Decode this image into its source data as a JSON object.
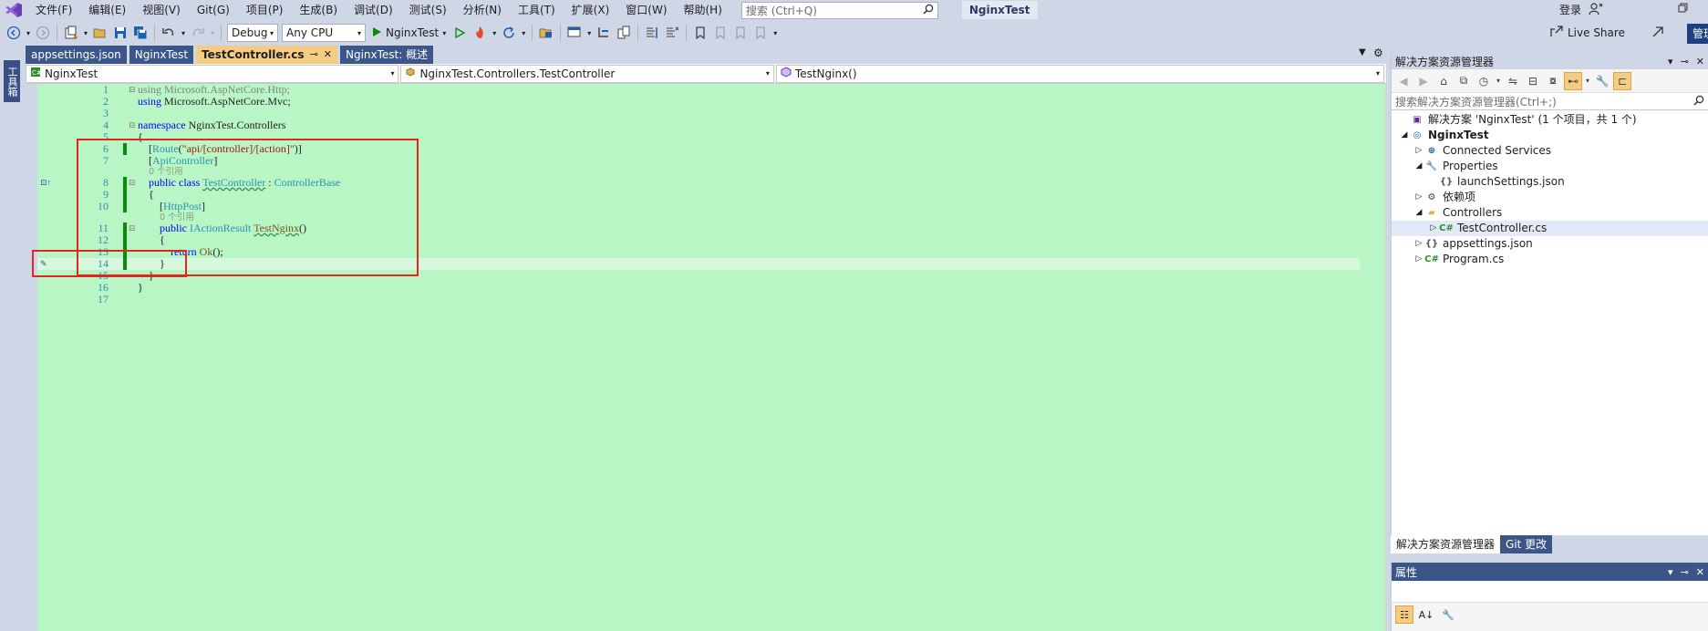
{
  "menubar": {
    "items": [
      "文件(F)",
      "编辑(E)",
      "视图(V)",
      "Git(G)",
      "项目(P)",
      "生成(B)",
      "调试(D)",
      "测试(S)",
      "分析(N)",
      "工具(T)",
      "扩展(X)",
      "窗口(W)",
      "帮助(H)"
    ],
    "search_placeholder": "搜索 (Ctrl+Q)",
    "solution_name": "NginxTest",
    "login": "登录"
  },
  "toolbar": {
    "configuration": "Debug",
    "platform": "Any CPU",
    "start_label": "NginxTest",
    "live_share": "Live Share",
    "manage": "管理"
  },
  "left_strip": {
    "toolbox": "工具箱"
  },
  "doc_tabs": [
    {
      "label": "appsettings.json",
      "active": false
    },
    {
      "label": "NginxTest",
      "active": false
    },
    {
      "label": "TestController.cs",
      "active": true
    },
    {
      "label": "NginxTest: 概述",
      "active": false
    }
  ],
  "tab_pin": "⊸",
  "tab_close": "✕",
  "navbar": {
    "project": "NginxTest",
    "type": "NginxTest.Controllers.TestController",
    "member": "TestNginx()"
  },
  "code": {
    "lines": [
      {
        "n": "1",
        "fold": "⊟",
        "tokens": [
          [
            "kw mu",
            "using"
          ],
          [
            "mu",
            " Microsoft.AspNetCore.Http;"
          ]
        ]
      },
      {
        "n": "2",
        "tokens": [
          [
            "kw",
            "using"
          ],
          [
            "",
            " Microsoft.AspNetCore.Mvc;"
          ]
        ]
      },
      {
        "n": "3",
        "tokens": []
      },
      {
        "n": "4",
        "fold": "⊟",
        "tokens": [
          [
            "kw",
            "namespace"
          ],
          [
            "",
            " NginxTest.Controllers"
          ]
        ]
      },
      {
        "n": "5",
        "tokens": [
          [
            "",
            "{"
          ]
        ]
      },
      {
        "n": "6",
        "bar": true,
        "tokens": [
          [
            "",
            "    ["
          ],
          [
            "ty",
            "Route"
          ],
          [
            "",
            "("
          ],
          [
            "str",
            "\"api/[controller]/[action]\""
          ],
          [
            "",
            ")]"
          ]
        ]
      },
      {
        "n": "7",
        "tokens": [
          [
            "",
            "    ["
          ],
          [
            "ty",
            "ApiController"
          ],
          [
            "",
            "]"
          ]
        ]
      },
      {
        "lens": true,
        "indent": "    ",
        "text": "0 个引用"
      },
      {
        "n": "8",
        "glyph": "⊡↑",
        "fold": "⊟",
        "bar": true,
        "tokens": [
          [
            "kw",
            "    public class "
          ],
          [
            "ty squig",
            "TestController"
          ],
          [
            "",
            " : "
          ],
          [
            "ty",
            "ControllerBase"
          ]
        ]
      },
      {
        "n": "9",
        "bar": true,
        "tokens": [
          [
            "",
            "    {"
          ]
        ]
      },
      {
        "n": "10",
        "bar": true,
        "tokens": [
          [
            "",
            "        ["
          ],
          [
            "ty",
            "HttpPost"
          ],
          [
            "",
            "]"
          ]
        ]
      },
      {
        "lens": true,
        "indent": "        ",
        "text": "0 个引用"
      },
      {
        "n": "11",
        "fold": "⊟",
        "bar": true,
        "tokens": [
          [
            "kw",
            "        public "
          ],
          [
            "ty",
            "IActionResult"
          ],
          [
            "",
            " "
          ],
          [
            "fn squig",
            "TestNginx"
          ],
          [
            "",
            "()"
          ]
        ]
      },
      {
        "n": "12",
        "bar": true,
        "tokens": [
          [
            "",
            "        {"
          ]
        ]
      },
      {
        "n": "13",
        "bar": true,
        "tokens": [
          [
            "kw",
            "            return "
          ],
          [
            "fn",
            "Ok"
          ],
          [
            "",
            "();"
          ]
        ]
      },
      {
        "n": "14",
        "glyph": "✎",
        "bar": true,
        "current": true,
        "tokens": [
          [
            "",
            "        }"
          ]
        ]
      },
      {
        "n": "15",
        "tokens": [
          [
            "",
            "    }"
          ]
        ]
      },
      {
        "n": "16",
        "tokens": [
          [
            "",
            "}"
          ]
        ]
      },
      {
        "n": "17",
        "tokens": []
      }
    ]
  },
  "solution_explorer": {
    "title": "解决方案资源管理器",
    "search_placeholder": "搜索解决方案资源管理器(Ctrl+;)",
    "tree": [
      {
        "label": "解决方案 'NginxTest' (1 个项目，共 1 个)",
        "indent": 0,
        "expander": "",
        "icon": "solution-icon",
        "glyph": "▣",
        "color": "#5c2d91"
      },
      {
        "label": "NginxTest",
        "indent": 0,
        "expander": "◢",
        "icon": "project-icon",
        "glyph": "◎",
        "color": "#1f5fb0",
        "bold": true
      },
      {
        "label": "Connected Services",
        "indent": 1,
        "expander": "▷",
        "icon": "connected-services-icon",
        "glyph": "⊕",
        "color": "#1f5fb0"
      },
      {
        "label": "Properties",
        "indent": 1,
        "expander": "◢",
        "icon": "properties-folder-icon",
        "glyph": "🔧",
        "color": "#8a6d2f"
      },
      {
        "label": "launchSettings.json",
        "indent": 2,
        "expander": "",
        "icon": "json-file-icon",
        "glyph": "{}",
        "color": "#555555"
      },
      {
        "label": "依赖项",
        "indent": 1,
        "expander": "▷",
        "icon": "dependencies-icon",
        "glyph": "⚙",
        "color": "#444444"
      },
      {
        "label": "Controllers",
        "indent": 1,
        "expander": "◢",
        "icon": "folder-icon",
        "glyph": "▰",
        "color": "#dcb354"
      },
      {
        "label": "TestController.cs",
        "indent": 2,
        "expander": "▷",
        "icon": "csharp-file-icon",
        "glyph": "C#",
        "color": "#2e8b2e",
        "selected": true
      },
      {
        "label": "appsettings.json",
        "indent": 1,
        "expander": "▷",
        "icon": "json-file-icon",
        "glyph": "{}",
        "color": "#555555"
      },
      {
        "label": "Program.cs",
        "indent": 1,
        "expander": "▷",
        "icon": "csharp-file-icon",
        "glyph": "C#",
        "color": "#2e8b2e"
      }
    ],
    "bottom_tabs": [
      "解决方案资源管理器",
      "Git 更改"
    ]
  },
  "properties": {
    "title": "属性"
  },
  "colors": {
    "editor_bg": "#b9f6c5",
    "chrome": "#cfd6e5",
    "active_tab": "#f5cc84",
    "highlight": "#e0261f"
  }
}
